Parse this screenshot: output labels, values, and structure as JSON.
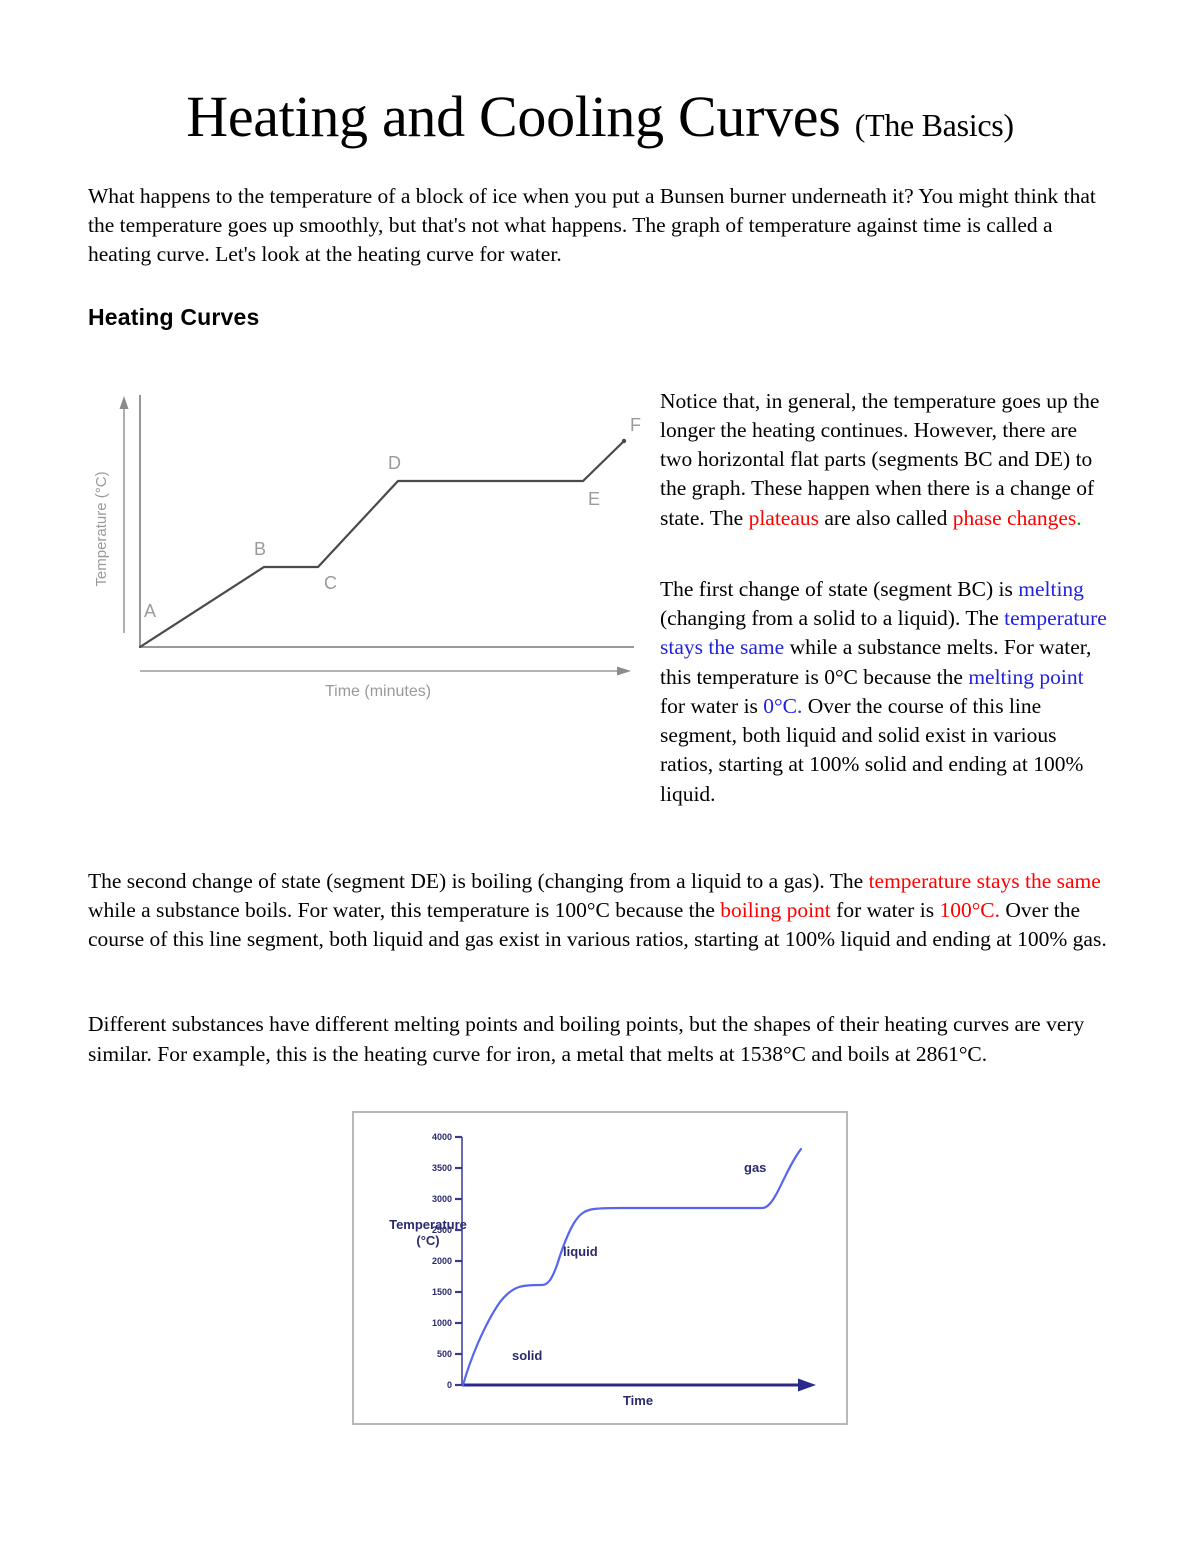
{
  "document": {
    "title_main": "Heating and Cooling Curves",
    "title_sub": "(The Basics)",
    "intro_paragraph": "What happens to the temperature of a block of ice when you put a Bunsen burner underneath it? You might think that the temperature goes up smoothly, but that's not what happens. The graph of temperature against time is called a heating curve. Let's look at the heating curve for water.",
    "section_heading": "Heating Curves",
    "notice_para": {
      "p1": "Notice that, in general, the temperature goes up the longer the heating continues. However, there are two horizontal flat parts (segments BC and DE) to the graph. These happen when there is a change of state. The ",
      "hl1": "plateaus",
      "p2": " are also called ",
      "hl2": "phase changes",
      "p3": "."
    },
    "melting_para": {
      "p1": "The first change of state (segment BC) is ",
      "hl1": "melting",
      "p2": " (changing from a solid to a liquid). The ",
      "hl2": "temperature stays the same",
      "p3": " while a substance melts. For water, this temperature is 0°C because the ",
      "hl3": "melting point",
      "p4": " for water is ",
      "hl4": "0°C.",
      "p5": "  Over the course of this line segment, both liquid and solid exist in various ratios, starting at 100% solid and ending at 100% liquid."
    },
    "boiling_para": {
      "p1": "The second change of state (segment DE) is boiling (changing from a liquid to a gas). The ",
      "hl1": "temperature stays the same",
      "p2": " while a substance boils. For water, this temperature is 100°C because the ",
      "hl2": "boiling point",
      "p3": " for water is ",
      "hl3": "100°C.",
      "p4": "  Over the course of this line segment, both liquid and gas exist in various ratios, starting at 100% liquid and ending at 100% gas."
    },
    "iron_para": "Different substances have different melting points and boiling points, but the shapes of their heating curves are very similar. For example, this is the heating curve for iron, a metal that melts at 1538°C and boils at 2861°C."
  },
  "colors": {
    "highlight_red": "#FF0000",
    "highlight_blue": "#2222DD",
    "water_curve": "#4a4a4a",
    "water_axis": "#8c8c8c",
    "water_label": "#9a9a9a",
    "iron_curve": "#5566EE",
    "iron_axis": "#3A3A8C",
    "iron_text": "#2A2A6E",
    "iron_border": "#b9b9b9"
  },
  "chart_data": [
    {
      "id": "water-heating-curve",
      "type": "line",
      "title": "",
      "xlabel": "Time (minutes)",
      "ylabel": "Temperature (°C)",
      "grid": false,
      "legend": "none",
      "annotations": [
        "A",
        "B",
        "C",
        "D",
        "E",
        "F"
      ],
      "point_labels": {
        "A": "A",
        "B": "B",
        "C": "C",
        "D": "D",
        "E": "E",
        "F": "F"
      },
      "x": [
        0,
        1.7,
        3.4,
        5.7,
        10.3,
        11.5
      ],
      "y": [
        0,
        2.5,
        2.5,
        6.0,
        6.0,
        7.1
      ],
      "series": [
        {
          "name": "water heating curve",
          "points": [
            {
              "label": "A",
              "x": 0,
              "y": 0
            },
            {
              "label": "B",
              "x": 1.7,
              "y": 2.5
            },
            {
              "label": "C",
              "x": 3.4,
              "y": 2.5
            },
            {
              "label": "D",
              "x": 5.7,
              "y": 6.0
            },
            {
              "label": "E",
              "x": 10.3,
              "y": 6.0
            },
            {
              "label": "F",
              "x": 11.5,
              "y": 7.1
            }
          ]
        }
      ],
      "xlim": [
        0,
        12.5
      ],
      "ylim": [
        0,
        8
      ]
    },
    {
      "id": "iron-heating-curve",
      "type": "line",
      "title": "",
      "xlabel": "Time",
      "ylabel": "Temperature\n(°C)",
      "ylabel_line1": "Temperature",
      "ylabel_line2": "(°C)",
      "grid": false,
      "legend": "none",
      "yticks": [
        0,
        500,
        1000,
        1500,
        2000,
        2500,
        3000,
        3500,
        4000
      ],
      "ytick_labels": [
        "0",
        "500",
        "1000",
        "1500",
        "2000",
        "2500",
        "3000",
        "3500",
        "4000"
      ],
      "ylim": [
        0,
        4000
      ],
      "xlim": [
        0,
        100
      ],
      "annotations": [
        {
          "text": "solid",
          "x": 16,
          "y": 700
        },
        {
          "text": "liquid",
          "x": 28,
          "y": 2200
        },
        {
          "text": "gas",
          "x": 80,
          "y": 3480
        }
      ],
      "series": [
        {
          "name": "iron heating curve",
          "x": [
            0,
            2,
            5,
            9,
            13,
            16,
            18,
            20,
            23,
            25,
            27,
            29,
            31,
            33,
            36,
            80,
            83,
            86,
            90,
            95
          ],
          "y": [
            0,
            330,
            700,
            1050,
            1330,
            1470,
            1520,
            1535,
            1540,
            1700,
            2050,
            2380,
            2600,
            2720,
            2780,
            2780,
            2900,
            3200,
            3500,
            3760
          ]
        }
      ],
      "melting_plateau_temp": 1538,
      "boiling_plateau_temp": 2861
    }
  ]
}
